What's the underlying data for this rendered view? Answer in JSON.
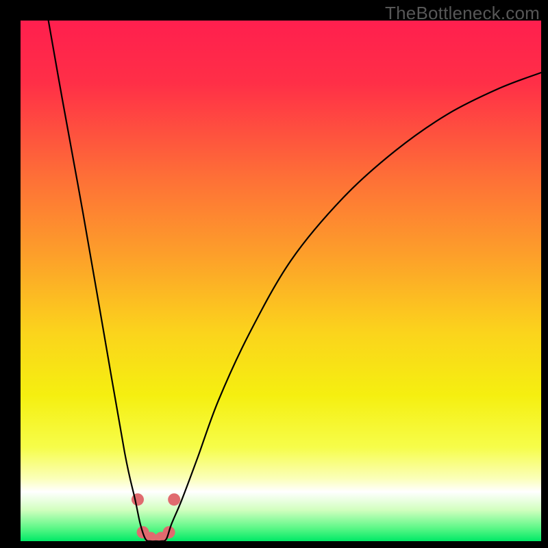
{
  "watermark": "TheBottleneck.com",
  "plot": {
    "outer_size": 800,
    "inner_left": 30,
    "inner_top": 30,
    "inner_width": 760,
    "inner_height": 760
  },
  "gradient_stops": [
    {
      "pos": 0.0,
      "color": "#ff1f4e"
    },
    {
      "pos": 0.12,
      "color": "#ff2f47"
    },
    {
      "pos": 0.3,
      "color": "#fe6f37"
    },
    {
      "pos": 0.45,
      "color": "#fd9f2a"
    },
    {
      "pos": 0.6,
      "color": "#fbd41c"
    },
    {
      "pos": 0.72,
      "color": "#f5ef10"
    },
    {
      "pos": 0.82,
      "color": "#f6fd4a"
    },
    {
      "pos": 0.88,
      "color": "#fbffba"
    },
    {
      "pos": 0.905,
      "color": "#ffffff"
    },
    {
      "pos": 0.94,
      "color": "#d2ffbf"
    },
    {
      "pos": 0.975,
      "color": "#5cf787"
    },
    {
      "pos": 1.0,
      "color": "#00e966"
    }
  ],
  "chart_data": {
    "type": "line",
    "title": "",
    "xlabel": "",
    "ylabel": "",
    "xlim": [
      0,
      100
    ],
    "ylim": [
      0,
      100
    ],
    "series": [
      {
        "name": "curve",
        "x": [
          5,
          8,
          12,
          16,
          20,
          22,
          23,
          24,
          25,
          26,
          27,
          28,
          29,
          31,
          34,
          38,
          44,
          52,
          62,
          72,
          82,
          92,
          100
        ],
        "y": [
          102,
          85,
          63,
          40,
          17,
          8,
          3.3,
          0.4,
          0,
          0,
          0,
          0.4,
          3.3,
          8,
          16,
          27,
          40,
          54,
          66,
          75,
          82,
          87,
          90
        ]
      }
    ],
    "highlight_points": [
      {
        "x": 22.5,
        "y": 8.0
      },
      {
        "x": 29.5,
        "y": 8.0
      },
      {
        "x": 23.5,
        "y": 1.7
      },
      {
        "x": 25.0,
        "y": 0.6
      },
      {
        "x": 27.0,
        "y": 0.6
      },
      {
        "x": 28.5,
        "y": 1.7
      }
    ],
    "highlight_marker": {
      "color": "#e06a6f",
      "radius_px": 9
    }
  }
}
